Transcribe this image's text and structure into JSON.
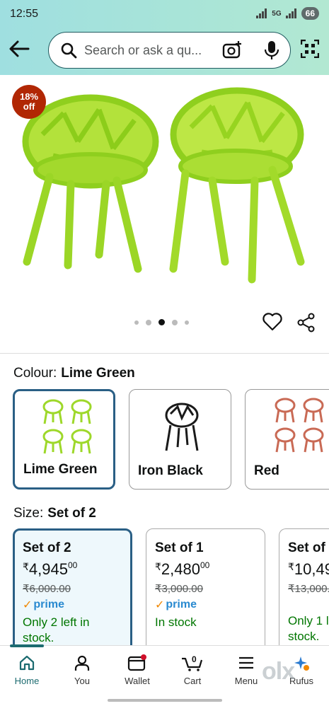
{
  "status": {
    "time": "12:55",
    "network": "5G",
    "battery": "66"
  },
  "search": {
    "placeholder": "Search or ask a qu..."
  },
  "product": {
    "discount_line1": "18%",
    "discount_line2": "off",
    "gallery_count": 5,
    "gallery_active": 3
  },
  "colour": {
    "label": "Colour:",
    "selected": "Lime Green",
    "options": [
      {
        "name": "Lime Green",
        "color": "#9ed82a"
      },
      {
        "name": "Iron Black",
        "color": "#1a1a1a"
      },
      {
        "name": "Red",
        "color": "#c96a55"
      }
    ]
  },
  "size": {
    "label": "Size:",
    "selected": "Set of 2",
    "options": [
      {
        "title": "Set of 2",
        "currency": "₹",
        "price": "4,945",
        "paise": "00",
        "mrp": "₹6,000.00",
        "prime": "prime",
        "stock": "Only 2 left in stock."
      },
      {
        "title": "Set of 1",
        "currency": "₹",
        "price": "2,480",
        "paise": "00",
        "mrp": "₹3,000.00",
        "prime": "prime",
        "stock": "In stock"
      },
      {
        "title": "Set of",
        "currency": "₹",
        "price": "10,49",
        "paise": "",
        "mrp": "₹13,000.",
        "prime": "",
        "stock": "Only 1 l stock."
      }
    ]
  },
  "nav": {
    "items": [
      {
        "label": "Home"
      },
      {
        "label": "You"
      },
      {
        "label": "Wallet"
      },
      {
        "label": "Cart"
      },
      {
        "label": "Menu"
      },
      {
        "label": "Rufus"
      }
    ],
    "cart_count": "0"
  },
  "watermark": "olx",
  "colors": {
    "accent": "#1c6b70",
    "selected_border": "#2a5f85",
    "deal_red": "#b12704",
    "stock_green": "#007600",
    "chair_lime": "#9ed82a"
  }
}
